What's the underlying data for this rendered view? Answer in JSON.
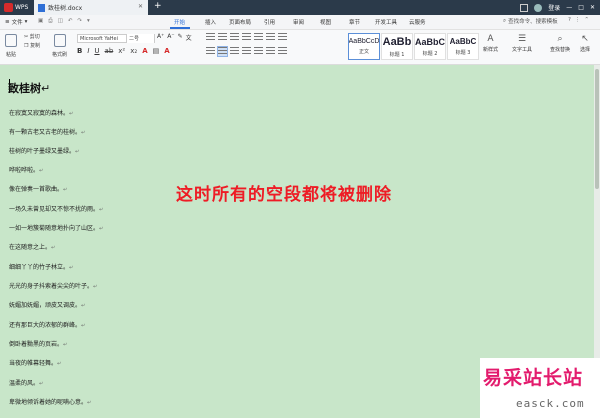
{
  "titlebar": {
    "app": "WPS",
    "tab_title": "致桂树.docx",
    "right": {
      "login": "登录"
    }
  },
  "menubar": {
    "file": "文件",
    "items": [
      {
        "label": "开始",
        "active": true
      },
      {
        "label": "插入"
      },
      {
        "label": "页面布局"
      },
      {
        "label": "引用"
      },
      {
        "label": "审阅"
      },
      {
        "label": "视图"
      },
      {
        "label": "章节"
      },
      {
        "label": "开发工具"
      },
      {
        "label": "云服务"
      }
    ],
    "search_placeholder": "查找命令、搜索模板"
  },
  "ribbon": {
    "paste": "粘贴",
    "cut": "剪切",
    "copy": "复制",
    "format_painter": "格式刷",
    "font_name": "Microsoft YaHei",
    "font_size": "二号",
    "styles": [
      {
        "sample": "AaBbCcD",
        "label": "正文",
        "active": true
      },
      {
        "sample": "AaBb",
        "label": "标题 1"
      },
      {
        "sample": "AaBbC",
        "label": "标题 2"
      },
      {
        "sample": "AaBbC",
        "label": "标题 3"
      }
    ],
    "new_style": "新样式",
    "text_tool": "文字工具",
    "find_replace": "查找替换",
    "select": "选择"
  },
  "document": {
    "title": "致桂树",
    "lines": [
      "在寂寞又寂寞的森林。",
      "有一颗古老又古老的桂树。",
      "桂树的叶子墨绿又墨绿。",
      "哗啦哗啦。",
      "像在弹奏一首歌曲。",
      "一场久未曾见却又不惊不扰的雨。",
      "一如一地簇菊随意地扑向了山区。",
      "在这随意之上。",
      "细细丫丫的竹子林立。",
      "光光的身子抖索着尖尖的叶子。",
      "妩媚加妩媚，顽皮又调皮。",
      "还有那巨大的浓郁的群峰。",
      "倒卧着黝黑的页岩。",
      "当夜的帷幕轻舞。",
      "温柔的风。",
      "卑微地倾诉着她的呢喃心意。"
    ]
  },
  "annotation": "这时所有的空段都将被删除",
  "watermark": {
    "text": "易采站长站",
    "url": "easck.com"
  },
  "colors": {
    "annotation": "#ee1c25",
    "doc_bg": "#c8e6c9",
    "accent": "#2f6fd6",
    "watermark": "#e31b6d"
  }
}
